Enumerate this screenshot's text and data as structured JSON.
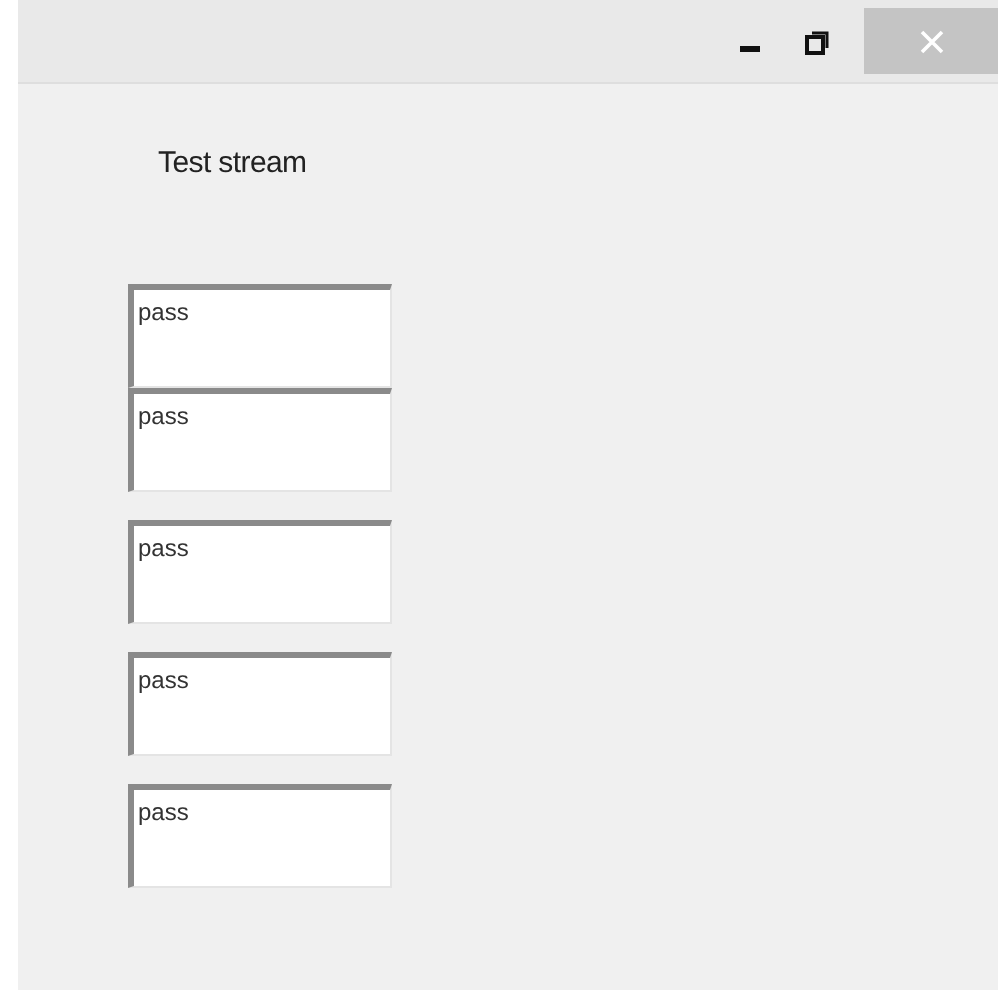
{
  "window": {
    "buttons": [
      {
        "kind": "minimize"
      },
      {
        "kind": "restore"
      },
      {
        "kind": "close"
      }
    ]
  },
  "label": "Test stream",
  "field_groups": [
    {
      "fields": [
        {
          "value": "pass"
        },
        {
          "value": "pass"
        }
      ]
    },
    {
      "fields": [
        {
          "value": "pass"
        }
      ]
    },
    {
      "fields": [
        {
          "value": "pass"
        }
      ]
    },
    {
      "fields": [
        {
          "value": "pass"
        }
      ]
    }
  ]
}
